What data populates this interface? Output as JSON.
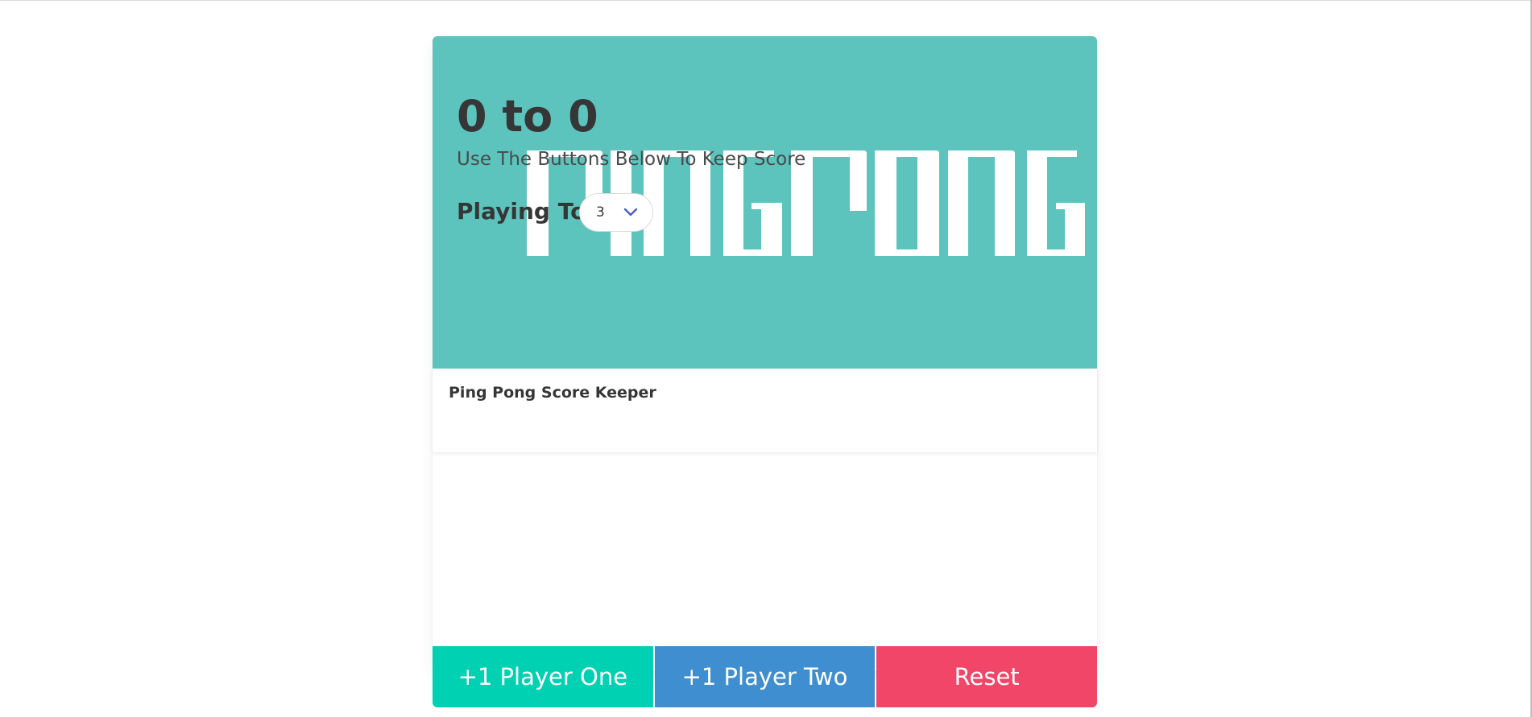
{
  "banner": {
    "text": "PINGPONG",
    "background_color": "#5cc4bd",
    "text_color": "#ffffff"
  },
  "card_header": {
    "title": "Ping Pong Score Keeper"
  },
  "scoreboard": {
    "score_text": "0 to 0",
    "subtitle": "Use The Buttons Below To Keep Score"
  },
  "playing_to": {
    "label": "Playing To",
    "selected_value": "3"
  },
  "buttons": {
    "player_one": "+1 Player One",
    "player_two": "+1 Player Two",
    "reset": "Reset"
  },
  "colors": {
    "player_one": "#00d1b2",
    "player_two": "#3e8ed0",
    "reset": "#f14668",
    "select_arrow": "#485fc7"
  }
}
